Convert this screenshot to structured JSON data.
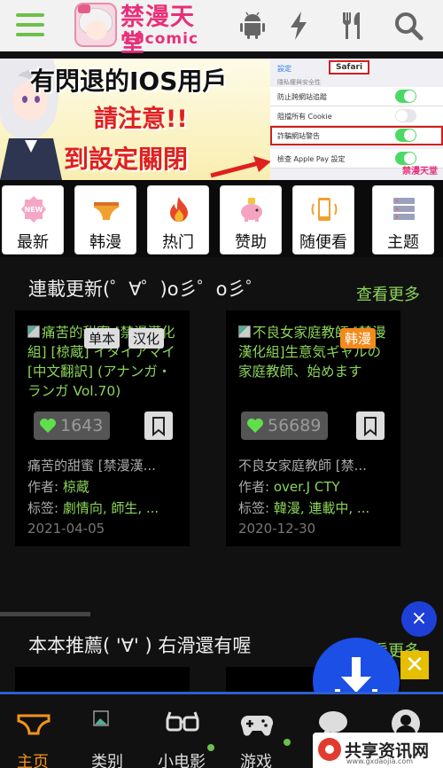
{
  "header": {
    "logo_title": "禁漫天堂",
    "logo_sub": "18comic",
    "icons": [
      "menu-icon",
      "android-icon",
      "lightning-icon",
      "fork-knife-icon",
      "search-icon"
    ]
  },
  "banner": {
    "line1": "有閃退的IOS用戶",
    "line2": "請注意!!",
    "line3": "到設定關閉",
    "settings_back": "設定",
    "settings_title": "Safari",
    "settings_section": "隱私權與安全性",
    "settings_rows": [
      {
        "label": "防止跨網站追蹤",
        "on": true
      },
      {
        "label": "阻擋所有 Cookie",
        "on": false
      },
      {
        "label": "詐騙網站警告",
        "on": true
      },
      {
        "label": "檢查 Apple Pay 設定",
        "on": true
      }
    ],
    "settings_brand": "禁漫天堂"
  },
  "categories": [
    "最新",
    "韩漫",
    "热门",
    "赞助",
    "随便看",
    "主题"
  ],
  "section1": {
    "title": "連載更新(゜∀゜)o彡゜o彡゜",
    "more": "查看更多"
  },
  "cards": [
    {
      "thumb_text": "痛苦的甜蜜 [禁漫漢化組] [椋蔵] イタイアマイ[中文翻訳] (アナンガ・ランガ Vol.70)",
      "badges": [
        "单本",
        "汉化"
      ],
      "likes": "1643",
      "title": "痛苦的甜蜜 [禁漫漢...",
      "author_label": "作者: ",
      "author": "椋蔵",
      "tags_label": "标签: ",
      "tags": "劇情向, 師生, ...",
      "date": "2021-04-05"
    },
    {
      "thumb_text": "不良女家庭教師 [禁漫漢化組]生意気ギャルの家庭教師、始めます",
      "badges": [
        "韩漫"
      ],
      "likes": "56689",
      "title": "不良女家庭教師 [禁...",
      "author_label": "作者: ",
      "author": "over.J CTY",
      "tags_label": "标签: ",
      "tags": "韓漫, 連載中, ...",
      "date": "2020-12-30"
    }
  ],
  "section2": {
    "title": "本本推薦( '∀' ) 右滑還有喔",
    "more": "查看更多"
  },
  "bottom_nav": [
    {
      "label": "主页",
      "active": true
    },
    {
      "label": "类别",
      "active": false
    },
    {
      "label": "小电影",
      "active": false
    },
    {
      "label": "游戏",
      "active": false
    },
    {
      "label": "论坛",
      "active": false
    },
    {
      "label": "我的",
      "active": false
    }
  ],
  "fab": {
    "close": "×",
    "x": "✕"
  },
  "watermark": {
    "text": "共享资讯网",
    "url": "www.gxdaojia.com"
  },
  "colors": {
    "accent_green": "#6cc04a",
    "brand_pink": "#e8307a",
    "nav_active": "#f39419",
    "fab_blue": "#1b4fe6"
  }
}
